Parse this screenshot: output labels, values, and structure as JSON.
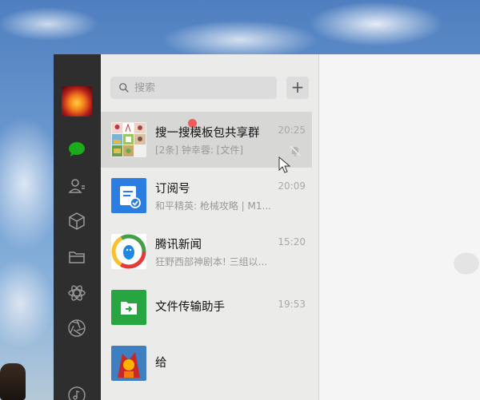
{
  "search": {
    "placeholder": "搜索"
  },
  "add_button": {
    "label": "+"
  },
  "chats": [
    {
      "name": "搜一搜模板包共享群",
      "time": "20:25",
      "preview": "[2条] 钟幸蓉: [文件]"
    },
    {
      "name": "订阅号",
      "time": "20:09",
      "preview": "和平精英: 枪械攻略 | M1..."
    },
    {
      "name": "腾讯新闻",
      "time": "15:20",
      "preview": "狂野西部神剧本! 三组以..."
    },
    {
      "name": "文件传输助手",
      "time": "19:53",
      "preview": ""
    },
    {
      "name": "给",
      "time": "",
      "preview": ""
    }
  ],
  "colors": {
    "nav_bg": "#2e2e2e",
    "accent_green": "#1aad19",
    "unread": "#f35a5a",
    "subscription_blue": "#2b7de1",
    "file_green": "#26a541"
  },
  "icons": {
    "nav": [
      "chat-bubble-icon",
      "contacts-icon",
      "cube-icon",
      "folder-icon",
      "atom-icon",
      "aperture-icon",
      "music-icon"
    ]
  }
}
